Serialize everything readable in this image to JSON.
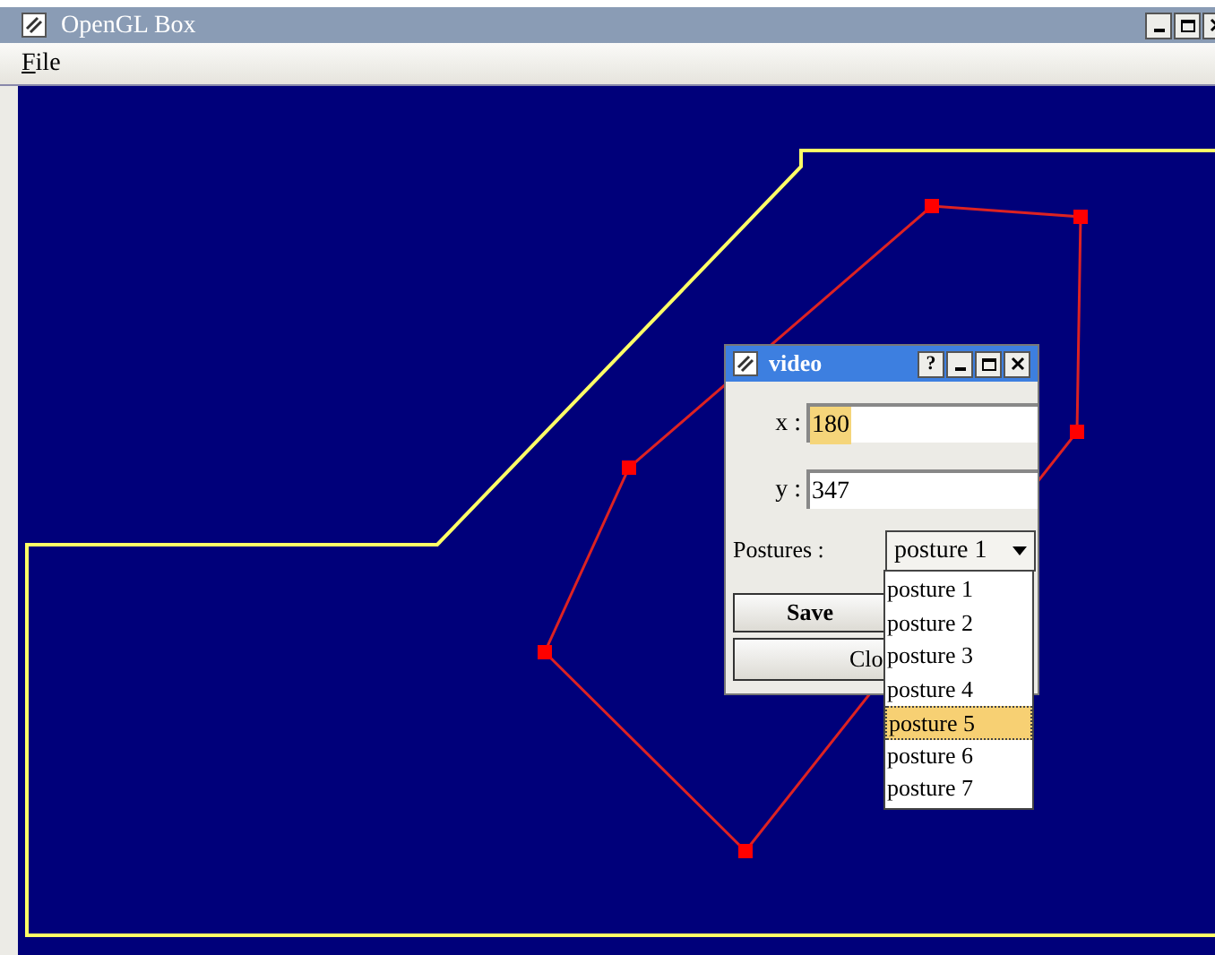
{
  "window": {
    "title": "OpenGL Box"
  },
  "menu": [
    {
      "label": "File"
    }
  ],
  "dialog": {
    "title": "video",
    "help": "?",
    "fields": [
      {
        "label": "x :",
        "value": "180",
        "highlighted": true
      },
      {
        "label": "y :",
        "value": "347",
        "highlighted": false
      }
    ],
    "postures": {
      "label": "Postures :",
      "value": "posture 1",
      "options": [
        {
          "label": "posture 1",
          "highlighted": false
        },
        {
          "label": "posture 2",
          "highlighted": false
        },
        {
          "label": "posture 3",
          "highlighted": false
        },
        {
          "label": "posture 4",
          "highlighted": false
        },
        {
          "label": "posture 5",
          "highlighted": true
        },
        {
          "label": "posture 6",
          "highlighted": false
        },
        {
          "label": "posture 7",
          "highlighted": false
        }
      ]
    },
    "buttons": [
      "Save",
      "Clo"
    ]
  }
}
